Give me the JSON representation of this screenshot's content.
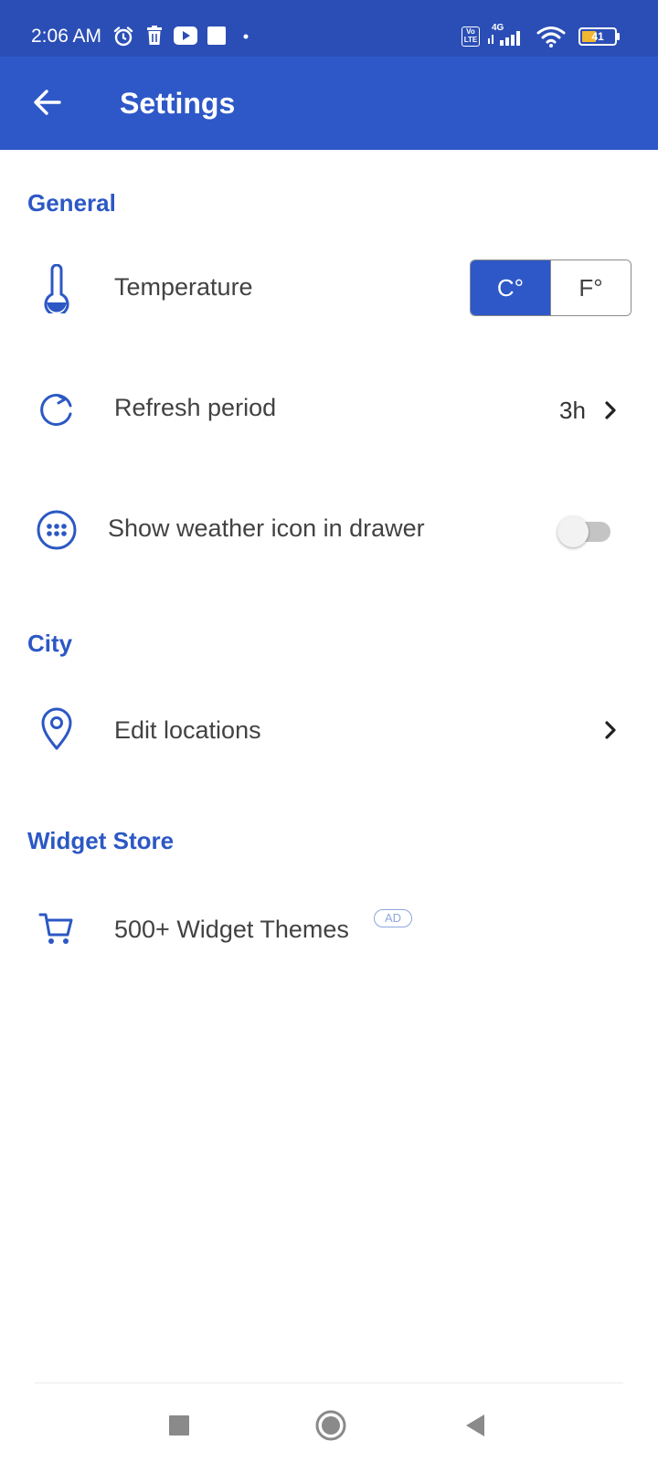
{
  "status_bar": {
    "time": "2:06 AM",
    "signal_label": "4G",
    "volte_label": "Vo LTE",
    "battery_level": "41",
    "icons": [
      "alarm-icon",
      "trash-icon",
      "youtube-icon",
      "square-notification-icon",
      "dot-icon",
      "volte-icon",
      "signal-icon",
      "wifi-icon",
      "battery-icon"
    ]
  },
  "app_bar": {
    "title": "Settings",
    "back_icon": "arrow-left-icon"
  },
  "sections": {
    "general": {
      "header": "General",
      "temperature": {
        "label": "Temperature",
        "icon": "thermometer-icon",
        "units": [
          "C°",
          "F°"
        ],
        "selected": "C°"
      },
      "refresh": {
        "label": "Refresh period",
        "icon": "refresh-icon",
        "value": "3h"
      },
      "drawer": {
        "label": "Show weather icon in drawer",
        "icon": "app-drawer-icon",
        "enabled": false
      }
    },
    "city": {
      "header": "City",
      "edit_locations": {
        "label": "Edit locations",
        "icon": "location-pin-icon"
      }
    },
    "widget_store": {
      "header": "Widget Store",
      "themes": {
        "label": "500+ Widget Themes",
        "badge": "AD",
        "icon": "cart-icon"
      }
    }
  },
  "colors": {
    "status_bar": "#2b4eb6",
    "app_bar": "#2e58c8",
    "accent": "#2c58c4",
    "text": "#424242"
  },
  "nav_bar": {
    "icons": [
      "recents-square-icon",
      "home-circle-icon",
      "back-triangle-icon"
    ]
  }
}
